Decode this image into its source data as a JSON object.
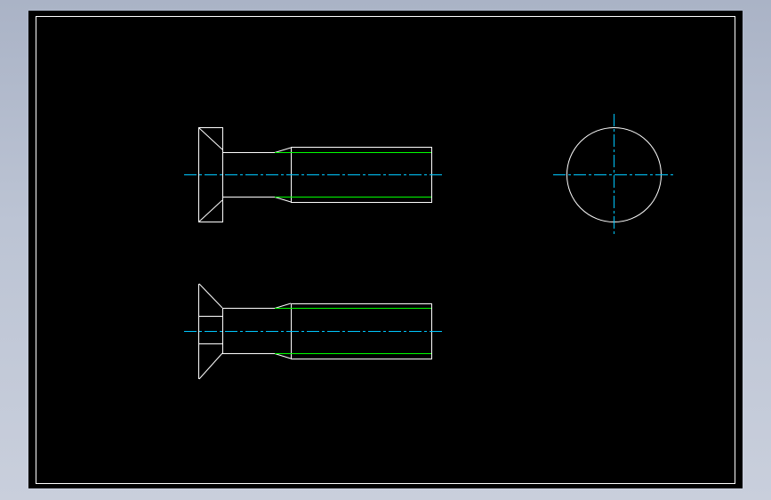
{
  "drawing": {
    "background": "#000000",
    "colors": {
      "outline": "#ffffff",
      "thread": "#00ff00",
      "centerline": "#00c8ff",
      "frame": "#ffffff"
    },
    "views": [
      {
        "name": "side-view-top",
        "description_icon": "bolt-side-icon"
      },
      {
        "name": "end-view",
        "description_icon": "circle-icon"
      },
      {
        "name": "side-view-bottom",
        "description_icon": "countersunk-bolt-icon"
      }
    ]
  }
}
